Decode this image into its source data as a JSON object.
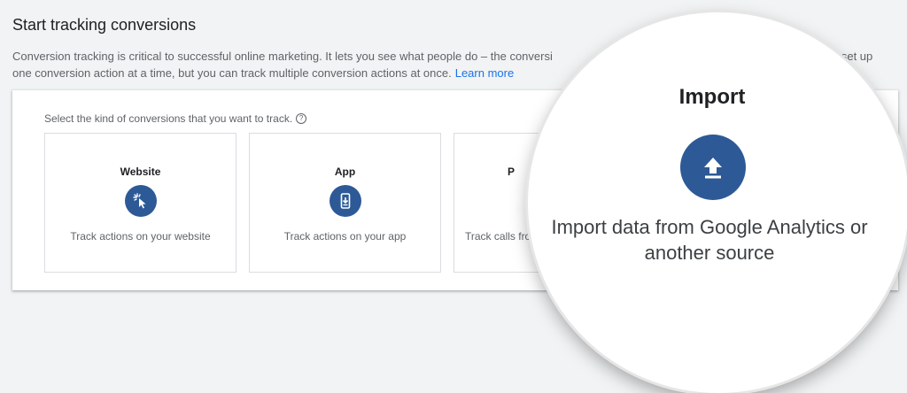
{
  "header": {
    "title": "Start tracking conversions"
  },
  "intro": {
    "line1": "Conversion tracking is critical to successful online marketing. It lets you see what people do – the conversi",
    "line2": "one conversion action at a time, but you can track multiple conversion actions at once.",
    "line1_tail": "u set up",
    "learn_more": "Learn more"
  },
  "panel": {
    "prompt": "Select the kind of conversions that you want to track.",
    "help_icon": "?",
    "cards": [
      {
        "title": "Website",
        "icon": "cursor-click-icon",
        "desc": "Track actions on your website"
      },
      {
        "title": "App",
        "icon": "phone-download-icon",
        "desc": "Track actions on your app"
      },
      {
        "title": "P",
        "icon": "phone-icon",
        "desc": "Track calls fro"
      }
    ]
  },
  "magnifier": {
    "title": "Import",
    "icon": "upload-icon",
    "desc_line1": "Import data from Google Analytics or",
    "desc_line2": "another source"
  },
  "colors": {
    "icon_blue": "#2d5a96",
    "link_blue": "#1a73e8"
  }
}
